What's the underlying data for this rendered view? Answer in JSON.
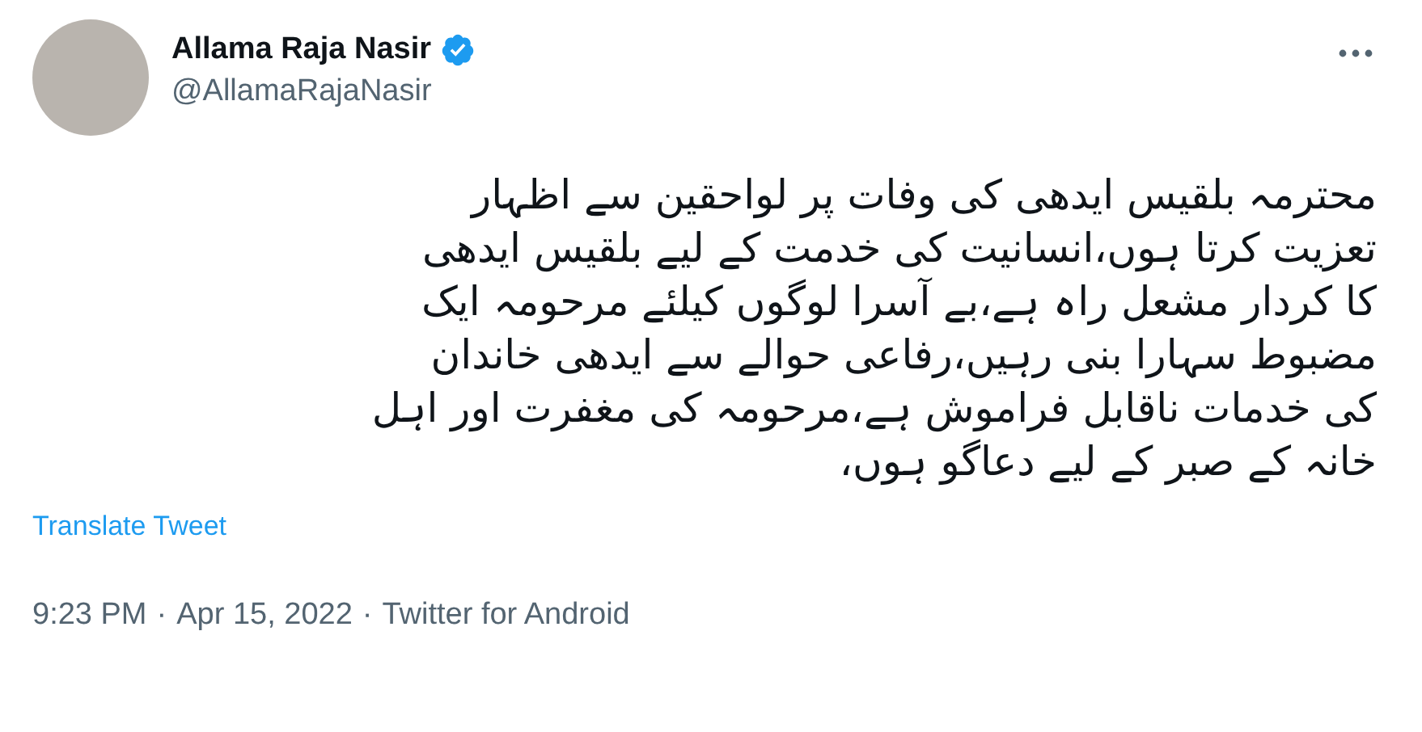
{
  "author": {
    "name": "Allama Raja Nasir",
    "verified": true,
    "handle": "@AllamaRajaNasir"
  },
  "tweet_text": "محترمہ بلقیس ایدھی کی وفات پر لواحقین سے اظہار\nتعزیت کرتا ہوں،انسانیت کی خدمت کے لیے بلقیس ایدھی\nکا کردار مشعل راہ ہے،بے آسرا لوگوں کیلئے مرحومہ ایک\nمضبوط سہارا بنی رہیں،رفاعی حوالے سے ایدھی خاندان\nکی خدمات ناقابل فراموش ہے،مرحومہ کی مغفرت  اور اہل\nخانہ کے صبر کے لیے دعاگو ہوں،",
  "translate_link": "Translate Tweet",
  "meta": {
    "time": "9:23 PM",
    "separator_1": "·",
    "date": "Apr 15, 2022",
    "separator_2": "·",
    "source": "Twitter for Android"
  }
}
